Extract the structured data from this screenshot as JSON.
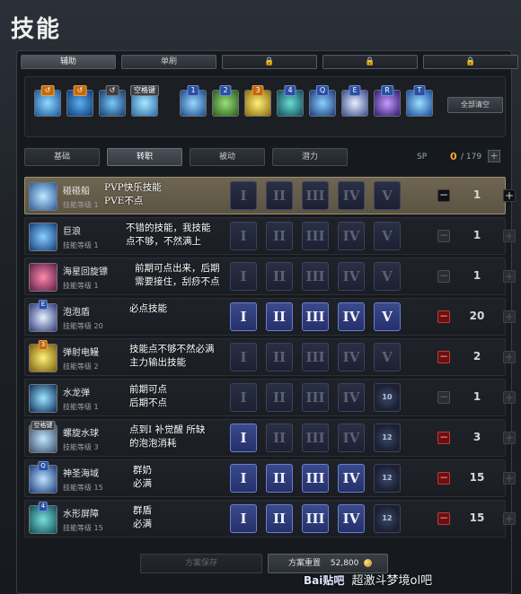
{
  "title": "技能",
  "top_tabs": [
    {
      "label": "辅助",
      "locked": false,
      "active": true
    },
    {
      "label": "单刷",
      "locked": false,
      "active": false
    },
    {
      "label": "🔒",
      "locked": true,
      "active": false
    },
    {
      "label": "🔒",
      "locked": true,
      "active": false
    },
    {
      "label": "🔒",
      "locked": true,
      "active": false
    }
  ],
  "slot_bar": {
    "slots": [
      {
        "key": "",
        "icon": "water-slide-icon"
      },
      {
        "key": "",
        "icon": "wave-icon"
      },
      {
        "key": "",
        "icon": "whirl-icon"
      },
      {
        "key": "空格键",
        "icon": "water-ball-icon"
      },
      {
        "key": "1",
        "icon": "sword-icon"
      },
      {
        "key": "2",
        "icon": "tree-icon"
      },
      {
        "key": "3",
        "icon": "burst-icon"
      },
      {
        "key": "4",
        "icon": "barrier-icon"
      },
      {
        "key": "Q",
        "icon": "sea-icon"
      },
      {
        "key": "E",
        "icon": "shield-icon"
      },
      {
        "key": "R",
        "icon": "bubbles-icon"
      },
      {
        "key": "T",
        "icon": "splash-icon"
      }
    ],
    "clear_label": "全部清空"
  },
  "sub_tabs": [
    "基础",
    "转职",
    "被动",
    "潜力"
  ],
  "sp": {
    "label": "SP",
    "used": "0",
    "total": "/ 179"
  },
  "tier_labels": [
    "I",
    "II",
    "III",
    "IV",
    "V"
  ],
  "skills": [
    {
      "name": "碰碰船",
      "level": "技能等级 1",
      "note": "PVP快乐技能\nPVE不点",
      "value": "1"
    },
    {
      "name": "巨浪",
      "level": "技能等级 1",
      "note": "不错的技能，我技能\n点不够，不然满上",
      "value": "1"
    },
    {
      "name": "海星回旋镖",
      "level": "技能等级 1",
      "note": "前期可点出来，后期\n需要接住，刮痧不点",
      "value": "1"
    },
    {
      "name": "泡泡盾",
      "level": "技能等级 20",
      "note": "必点技能",
      "value": "20"
    },
    {
      "name": "弹射电鳗",
      "level": "技能等级 2",
      "note": "技能点不够不然必满\n主力输出技能",
      "value": "2"
    },
    {
      "name": "水龙弹",
      "level": "技能等级 1",
      "note": "前期可点\n后期不点",
      "value": "1",
      "max_tier": "10"
    },
    {
      "name": "螺旋水球",
      "level": "技能等级 3",
      "note": "点到I 补觉醒 所缺\n的泡泡消耗",
      "value": "3",
      "max_tier": "12"
    },
    {
      "name": "神圣海域",
      "level": "技能等级 15",
      "note": "群奶\n必满",
      "value": "15",
      "max_tier": "12"
    },
    {
      "name": "水形屏障",
      "level": "技能等级 15",
      "note": "群盾\n必满",
      "value": "15",
      "max_tier": "12"
    }
  ],
  "footer": {
    "save_label": "方案保存",
    "reset_label": "方案重置",
    "reset_cost": "52,800"
  },
  "watermark": {
    "logo": "Bai贴吧",
    "text": "超激斗梦境ol吧"
  }
}
